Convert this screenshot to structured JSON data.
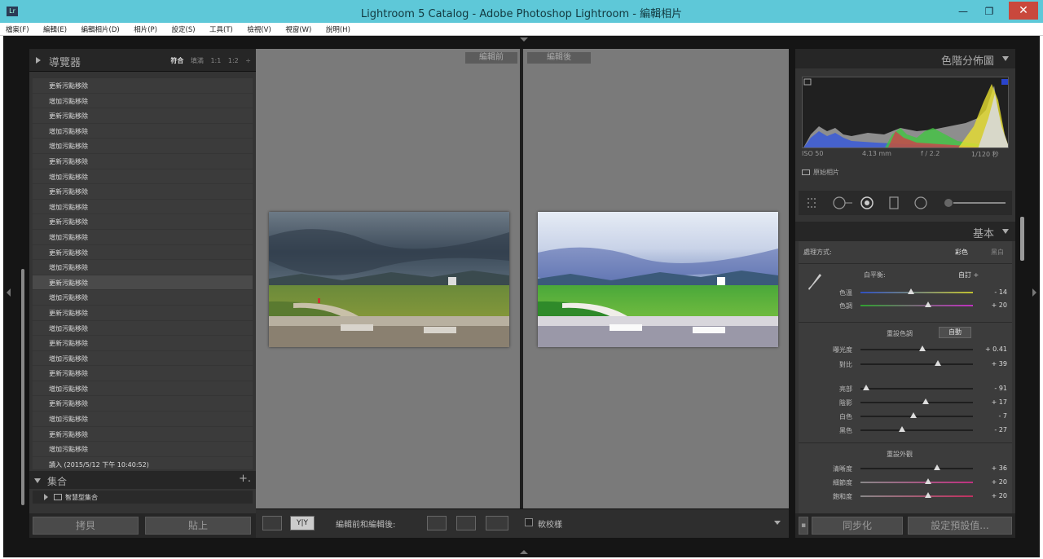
{
  "window": {
    "title": "Lightroom 5 Catalog - Adobe Photoshop Lightroom - 編輯相片",
    "app_icon": "Lr"
  },
  "menu": [
    "檔案(F)",
    "編輯(E)",
    "編輯相片(D)",
    "相片(P)",
    "設定(S)",
    "工具(T)",
    "檢視(V)",
    "視窗(W)",
    "說明(H)"
  ],
  "navigator": {
    "title": "導覽器",
    "opts": [
      "符合",
      "填滿",
      "1:1",
      "1:2"
    ]
  },
  "history": {
    "items": [
      "更新污點移除",
      "增加污點移除",
      "更新污點移除",
      "增加污點移除",
      "增加污點移除",
      "更新污點移除",
      "增加污點移除",
      "更新污點移除",
      "增加污點移除",
      "更新污點移除",
      "增加污點移除",
      "更新污點移除",
      "增加污點移除",
      "更新污點移除",
      "增加污點移除",
      "更新污點移除",
      "增加污點移除",
      "更新污點移除",
      "增加污點移除",
      "更新污點移除",
      "增加污點移除",
      "更新污點移除",
      "增加污點移除",
      "更新污點移除",
      "增加污點移除"
    ],
    "import": "讀入 (2015/5/12 下午 10:40:52)"
  },
  "collections": {
    "title": "集合",
    "add": "+.",
    "item": "智慧型集合"
  },
  "left_buttons": {
    "copy": "拷貝",
    "paste": "貼上"
  },
  "view": {
    "before": "編輯前",
    "after": "編輯後"
  },
  "toolbar": {
    "yy": "Y|Y",
    "mode_label": "編輯前和編輯後:",
    "proof_label": "軟校樣"
  },
  "histogram_panel": {
    "title": "色階分佈圖",
    "iso": "ISO 50",
    "focal": "4.13 mm",
    "aperture": "f / 2.2",
    "shutter": "1/120 秒",
    "original": "原始相片"
  },
  "basic": {
    "title": "基本",
    "treatment_label": "處理方式:",
    "treatment_color": "彩色",
    "treatment_bw": "黑白",
    "wb_label": "白平衡:",
    "wb_value": "自訂 ÷",
    "temp": {
      "label": "色溫",
      "value": "- 14",
      "level": 0.45
    },
    "tint": {
      "label": "色調",
      "value": "+ 20",
      "level": 0.6
    },
    "tone_label": "色調",
    "preset_tone": "重設色調",
    "auto": "自動",
    "exposure": {
      "label": "曝光度",
      "value": "+ 0.41",
      "level": 0.55
    },
    "contrast": {
      "label": "對比",
      "value": "+ 39",
      "level": 0.69
    },
    "highlights": {
      "label": "亮部",
      "value": "- 91",
      "level": 0.05
    },
    "shadows": {
      "label": "陰影",
      "value": "+ 17",
      "level": 0.58
    },
    "whites": {
      "label": "白色",
      "value": "- 7",
      "level": 0.47
    },
    "blacks": {
      "label": "黑色",
      "value": "- 27",
      "level": 0.37
    },
    "presence_label": "重設外觀",
    "clarity": {
      "label": "清晰度",
      "value": "+ 36",
      "level": 0.68
    },
    "vibrance": {
      "label": "細節度",
      "value": "+ 20",
      "level": 0.6
    },
    "saturation": {
      "label": "飽和度",
      "value": "+ 20",
      "level": 0.6
    }
  },
  "right_buttons": {
    "sync": "同步化",
    "reset": "設定預設值..."
  }
}
